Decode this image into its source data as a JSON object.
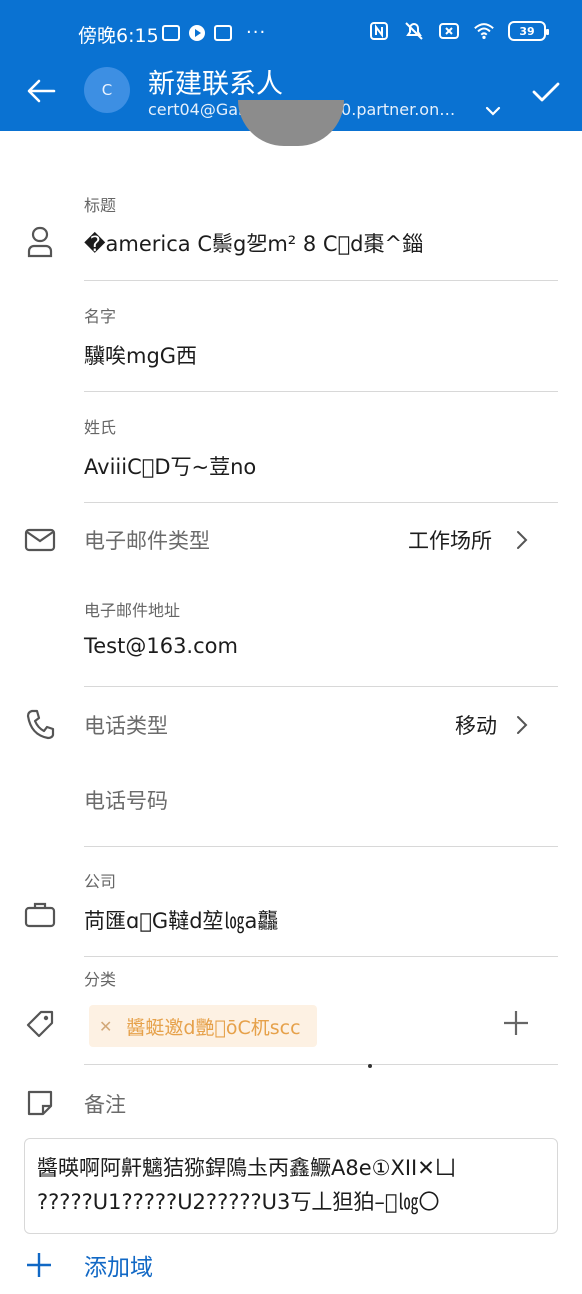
{
  "status_bar": {
    "time": "傍晚6:15",
    "battery": "39"
  },
  "header": {
    "title": "新建联系人",
    "account_initial": "C",
    "account_email": "cert04@GallatinTenant10.partner.onm..."
  },
  "fields": {
    "title_label": "标题",
    "title_value": "�america C鬃g乫m² 8 C\u0000d棗^錙",
    "firstname_label": "名字",
    "firstname_value": "驥唉mgG西",
    "lastname_label": "姓氏",
    "lastname_value": "AviiiC\u0000D丂~荳no",
    "email_type_label": "电子邮件类型",
    "email_type_value": "工作场所",
    "email_address_label": "电子邮件地址",
    "email_address_value": "Test@163.com",
    "phone_type_label": "电话类型",
    "phone_type_value": "移动",
    "phone_number_placeholder": "电话号码",
    "company_label": "公司",
    "company_value": "苘匯ɑ\u0000G韃d堃㏒a龘",
    "category_label": "分类",
    "category_chip": "醬蜓邀d艷\u0000ōC杌scc",
    "notes_label": "备注",
    "notes_line1": "醬暎啊阿鼾魑狤猕銲隝圡丙鑫鱖A8e①XII✕凵",
    "notes_line2": "?????U1?????U2?????U3丂丄狚狛–\u0000㏒〇"
  },
  "add_field_label": "添加域",
  "colors": {
    "header_bg": "#0a72d2",
    "link_blue": "#1168c5",
    "chip_bg": "#fdf1e3",
    "chip_text": "#e6a14a"
  }
}
